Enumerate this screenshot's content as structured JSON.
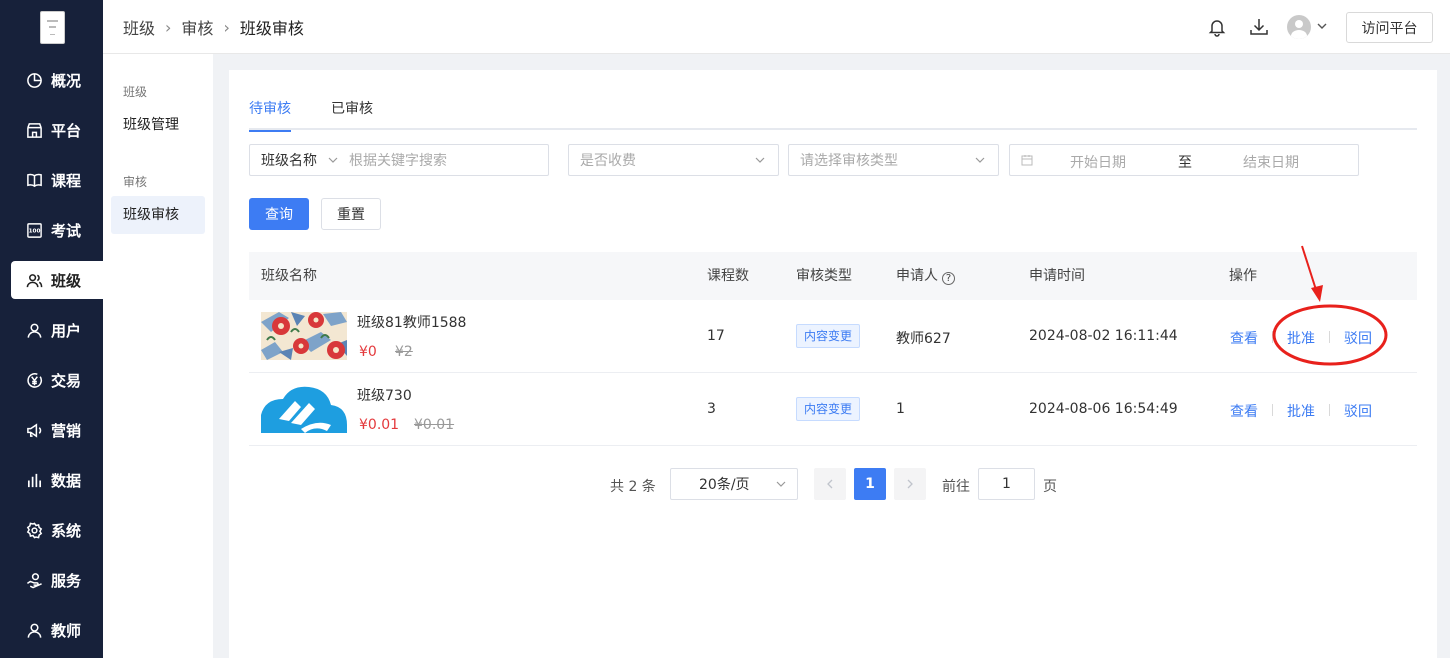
{
  "nav": {
    "items": [
      {
        "label": "概况",
        "icon": "pie-chart-icon"
      },
      {
        "label": "平台",
        "icon": "store-icon"
      },
      {
        "label": "课程",
        "icon": "book-icon"
      },
      {
        "label": "考试",
        "icon": "exam-100-icon"
      },
      {
        "label": "班级",
        "icon": "users-icon",
        "active": true
      },
      {
        "label": "用户",
        "icon": "user-icon"
      },
      {
        "label": "交易",
        "icon": "yen-circle-icon"
      },
      {
        "label": "营销",
        "icon": "megaphone-icon"
      },
      {
        "label": "数据",
        "icon": "bar-chart-icon"
      },
      {
        "label": "系统",
        "icon": "gear-icon"
      },
      {
        "label": "服务",
        "icon": "service-hand-icon"
      },
      {
        "label": "教师",
        "icon": "teacher-icon"
      }
    ]
  },
  "submenu": {
    "group1": "班级",
    "item1": "班级管理",
    "group2": "审核",
    "item2": "班级审核"
  },
  "header": {
    "breadcrumb": [
      "班级",
      "审核",
      "班级审核"
    ],
    "visit_label": "访问平台"
  },
  "tabs": [
    {
      "label": "待审核",
      "active": true
    },
    {
      "label": "已审核",
      "active": false
    }
  ],
  "filters": {
    "name_select": "班级名称",
    "keyword_placeholder": "根据关键字搜索",
    "fee_placeholder": "是否收费",
    "type_placeholder": "请选择审核类型",
    "start_placeholder": "开始日期",
    "range_sep": "至",
    "end_placeholder": "结束日期"
  },
  "buttons": {
    "query": "查询",
    "reset": "重置"
  },
  "table": {
    "headers": {
      "name": "班级名称",
      "courses": "课程数",
      "type": "审核类型",
      "applicant": "申请人",
      "time": "申请时间",
      "ops": "操作"
    },
    "rows": [
      {
        "name": "班级81教师1588",
        "price": "¥0",
        "original_price": "¥2",
        "courses": "17",
        "type": "内容变更",
        "applicant": "教师627",
        "time": "2024-08-02 16:11:44"
      },
      {
        "name": "班级730",
        "price": "¥0.01",
        "original_price": "¥0.01",
        "courses": "3",
        "type": "内容变更",
        "applicant": "1",
        "time": "2024-08-06 16:54:49"
      }
    ],
    "actions": {
      "view": "查看",
      "approve": "批准",
      "reject": "驳回"
    }
  },
  "pagination": {
    "total": "共 2 条",
    "page_size": "20条/页",
    "current": "1",
    "goto_prefix": "前往",
    "goto_value": "1",
    "goto_suffix": "页"
  },
  "colors": {
    "sidebar": "#17213a",
    "accent": "#3d7cf3",
    "price": "#e4393c",
    "annotation": "#e8211c"
  }
}
